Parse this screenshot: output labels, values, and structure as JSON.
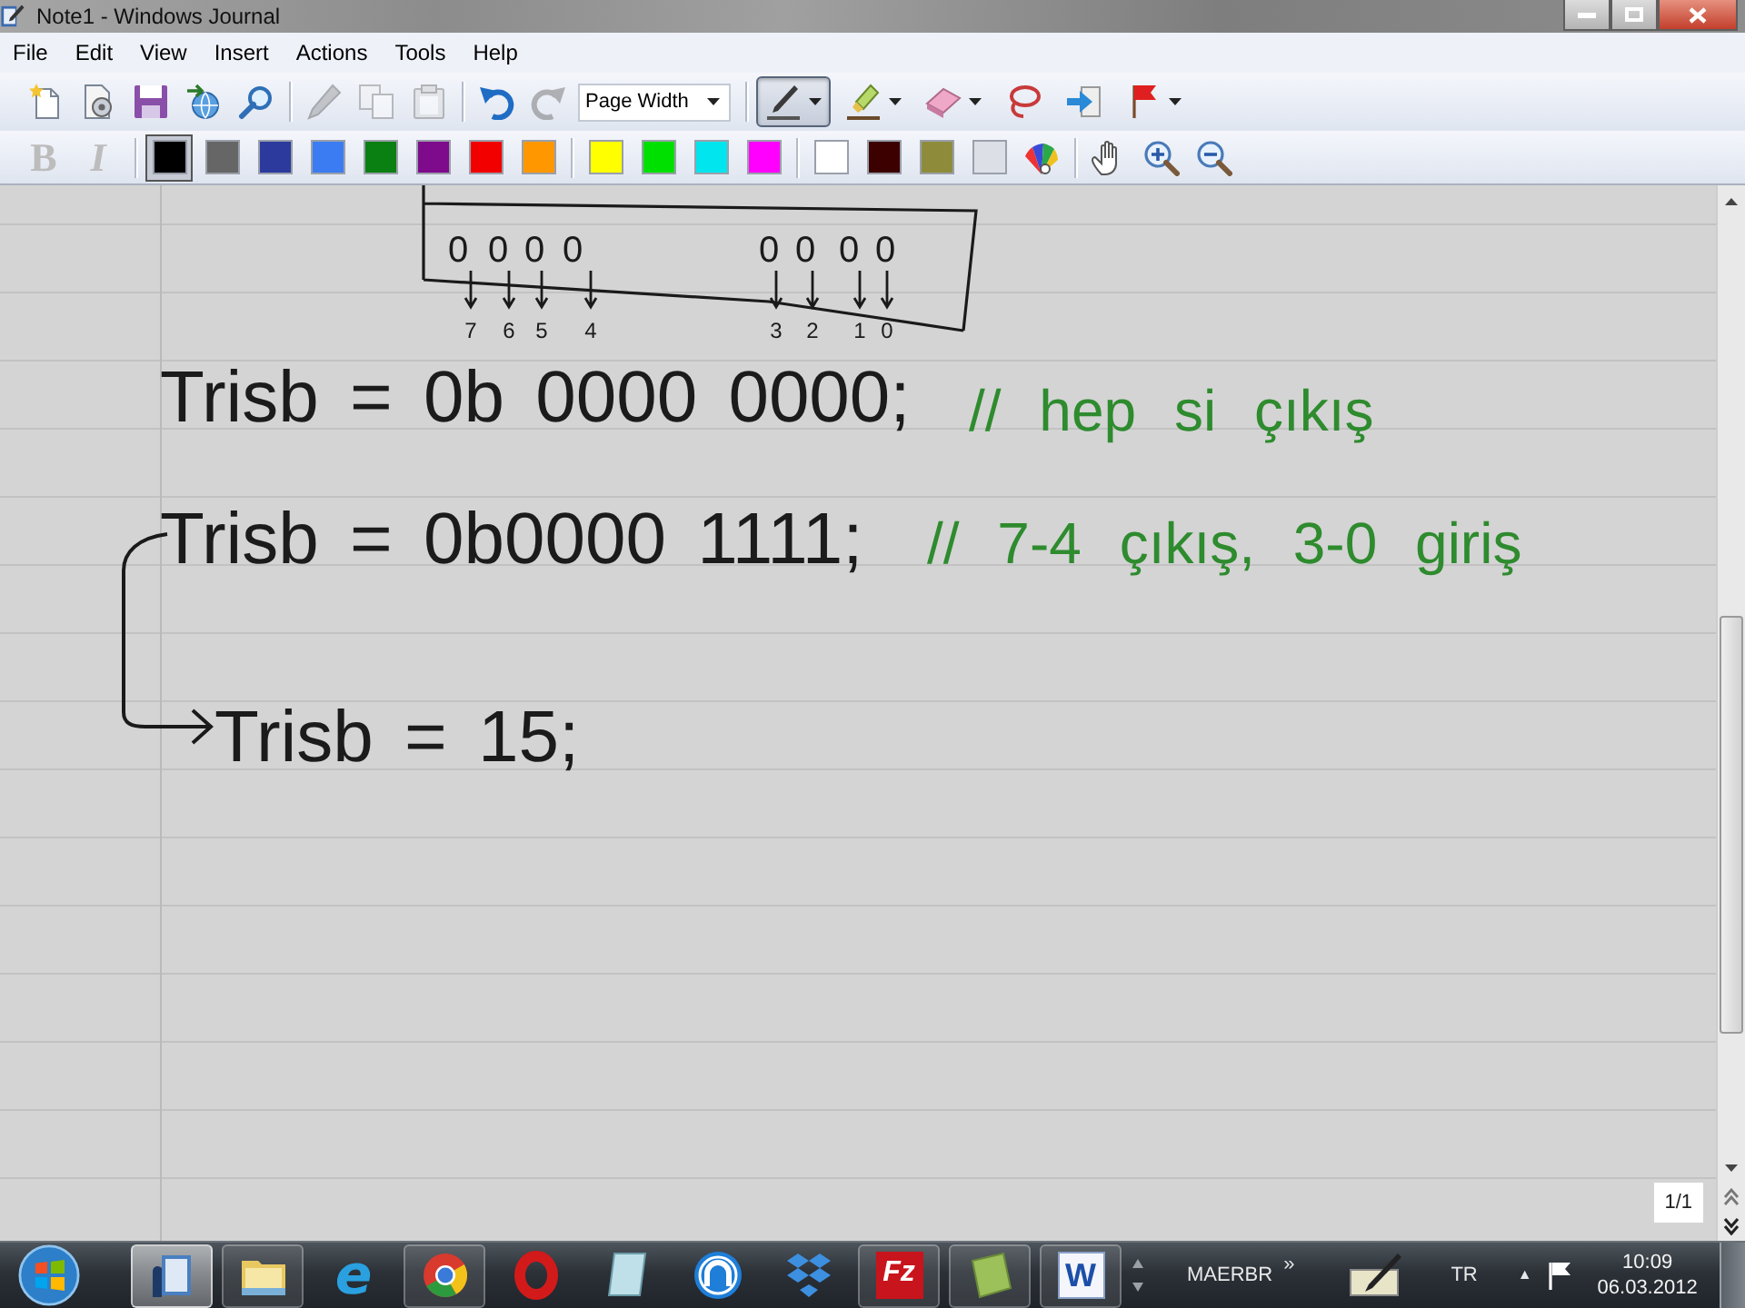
{
  "window": {
    "title": "Note1 - Windows Journal"
  },
  "menu": [
    "File",
    "Edit",
    "View",
    "Insert",
    "Actions",
    "Tools",
    "Help"
  ],
  "standard_toolbar": {
    "buttons": [
      {
        "kind": "new",
        "disabled": false
      },
      {
        "kind": "template",
        "disabled": false
      },
      {
        "kind": "save",
        "disabled": false
      },
      {
        "kind": "send",
        "disabled": false
      },
      {
        "kind": "find",
        "disabled": false
      },
      {
        "kind": "cut",
        "disabled": true
      },
      {
        "kind": "copy",
        "disabled": true
      },
      {
        "kind": "paste",
        "disabled": true
      },
      {
        "kind": "undo",
        "disabled": false
      },
      {
        "kind": "redo",
        "disabled": true
      }
    ],
    "zoom": {
      "value": "Page Width"
    },
    "tools": [
      {
        "kind": "pen",
        "selected": true
      },
      {
        "kind": "highlighter",
        "selected": false
      },
      {
        "kind": "eraser",
        "selected": false
      },
      {
        "kind": "lasso",
        "selected": false
      },
      {
        "kind": "space",
        "selected": false
      },
      {
        "kind": "flag",
        "selected": false
      }
    ]
  },
  "format_toolbar": {
    "buttons": [
      {
        "label": "B",
        "disabled": true
      },
      {
        "label": "I",
        "disabled": true
      }
    ],
    "color_groups": [
      {
        "colors": [
          {
            "color": "#000000",
            "selected": true
          },
          {
            "color": "#666666",
            "selected": false
          },
          {
            "color": "#2c3a9e",
            "selected": false
          },
          {
            "color": "#3b7cf2",
            "selected": false
          },
          {
            "color": "#0a7f12",
            "selected": false
          },
          {
            "color": "#7e0a8c",
            "selected": false
          },
          {
            "color": "#f20000",
            "selected": false
          },
          {
            "color": "#ff9800",
            "selected": false
          }
        ]
      },
      {
        "colors": [
          {
            "color": "#ffff00",
            "selected": false
          },
          {
            "color": "#00e000",
            "selected": false
          },
          {
            "color": "#00e5ee",
            "selected": false
          },
          {
            "color": "#ff00ff",
            "selected": false
          }
        ]
      },
      {
        "colors": [
          {
            "color": "#ffffff",
            "selected": false
          },
          {
            "color": "#3c0000",
            "selected": false
          },
          {
            "color": "#8e8c3a",
            "selected": false
          },
          {
            "color": "#dcdfe6",
            "selected": false
          }
        ]
      }
    ]
  },
  "page": {
    "diagram": {
      "bits": [
        "0",
        "0",
        "0",
        "0",
        "0",
        "0",
        "0",
        "0"
      ],
      "bit_numbers": [
        "7",
        "6",
        "5",
        "4",
        "3",
        "2",
        "1",
        "0"
      ]
    },
    "lines": [
      {
        "code": "Trisb = 0b 0000 0000;",
        "comment": "// hep si çıkış"
      },
      {
        "code": "Trisb = 0b0000 1111;",
        "comment": "// 7-4 çıkış, 3-0 giriş"
      },
      {
        "code": "Trisb = 15;"
      }
    ],
    "page_indicator": "1/1"
  },
  "taskbar": {
    "apps": [
      {
        "kind": "notebook",
        "running": true,
        "selected": true
      },
      {
        "kind": "folder",
        "running": true,
        "selected": false
      },
      {
        "kind": "e_logo",
        "glyph": "e",
        "running": false,
        "selected": false
      },
      {
        "kind": "circle",
        "running": true,
        "selected": false
      },
      {
        "kind": "ring",
        "running": false,
        "selected": false
      },
      {
        "kind": "tablet",
        "running": false,
        "selected": false
      },
      {
        "kind": "arch",
        "running": false,
        "selected": false
      },
      {
        "kind": "diamonds",
        "running": false,
        "selected": false
      },
      {
        "kind": "fz_logo",
        "glyph": "Fz",
        "running": true,
        "selected": false
      },
      {
        "kind": "note",
        "running": true,
        "selected": false
      },
      {
        "kind": "w_logo",
        "glyph": "W",
        "running": true,
        "selected": false
      }
    ],
    "toolbar_label": "MAERBR",
    "toolbar_chevron": "»",
    "language": "TR",
    "tray_expander": "▲",
    "time": "10:09",
    "date": "06.03.2012"
  }
}
